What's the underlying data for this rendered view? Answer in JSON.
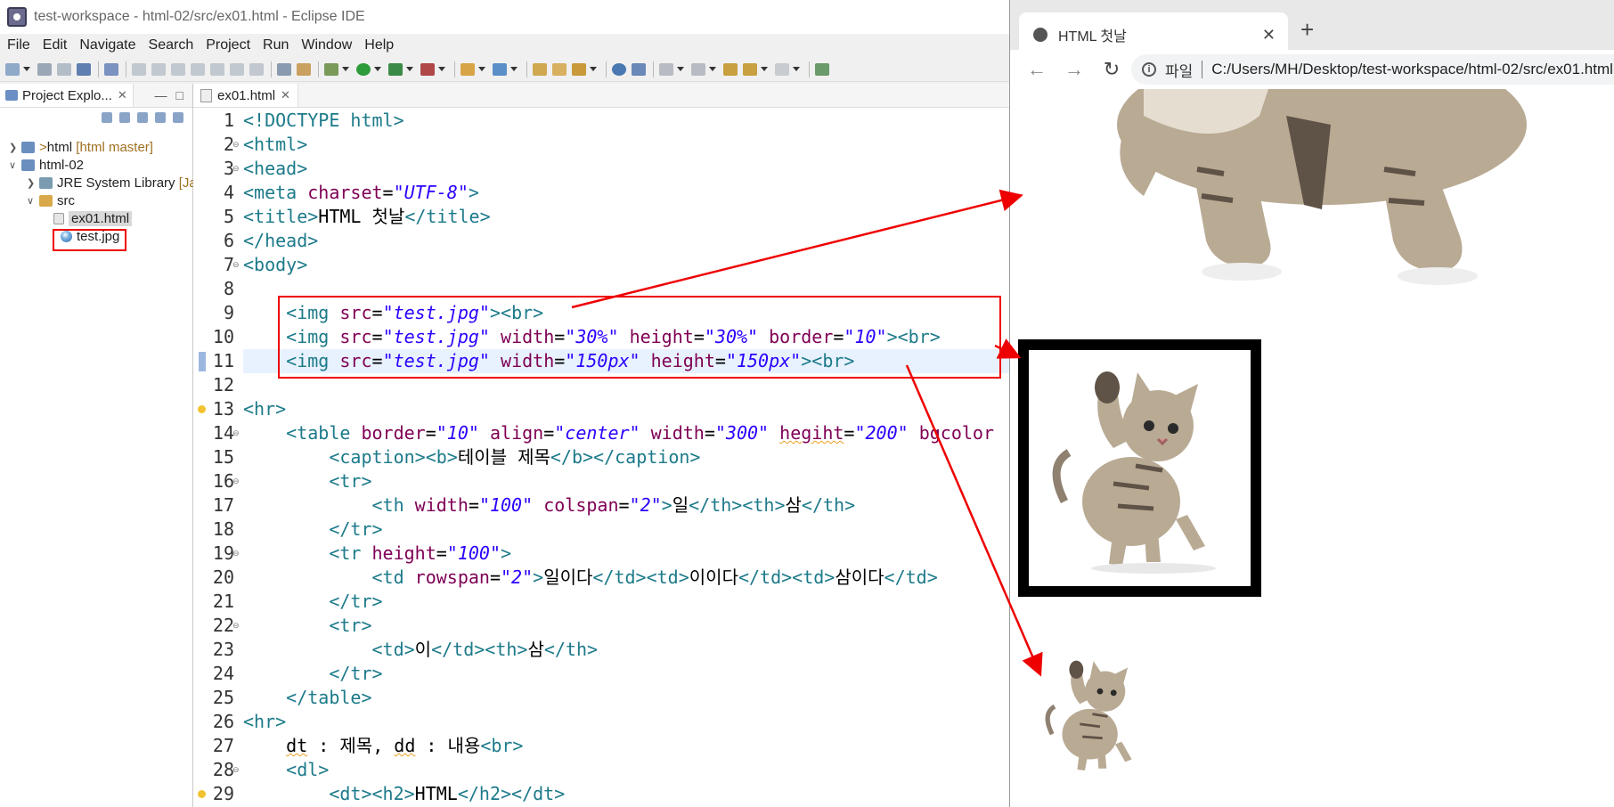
{
  "window_title": "test-workspace - html-02/src/ex01.html - Eclipse IDE",
  "menu": [
    "File",
    "Edit",
    "Navigate",
    "Search",
    "Project",
    "Run",
    "Window",
    "Help"
  ],
  "explorer": {
    "tab_label": "Project Explo...",
    "close": "✕",
    "min": "—",
    "max": "□",
    "tree": {
      "html_project": "html",
      "html_decor": "> ",
      "html_branch": "[html master]",
      "html02": "html-02",
      "jre": "JRE System Library",
      "jre_suffix": "[Ja",
      "src": "src",
      "file1": "ex01.html",
      "file2": "test.jpg"
    }
  },
  "editor": {
    "tab_label": "ex01.html",
    "close": "✕"
  },
  "browser": {
    "tab_title": "HTML 첫날",
    "tab_close": "✕",
    "new_tab": "+",
    "back": "←",
    "forward": "→",
    "reload": "↻",
    "scheme": "파일",
    "url": "C:/Users/MH/Desktop/test-workspace/html-02/src/ex01.html"
  }
}
